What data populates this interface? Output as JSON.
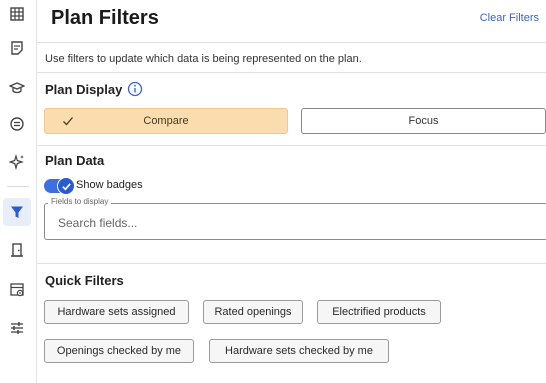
{
  "sidebar": {
    "items": [
      {
        "icon": "grid-icon",
        "active": false
      },
      {
        "icon": "document-icon",
        "active": false
      },
      {
        "icon": "graduation-cap-icon",
        "active": false
      },
      {
        "icon": "circle-lines-icon",
        "active": false
      },
      {
        "icon": "sparkle-icon",
        "active": false
      },
      {
        "icon": "filter-icon",
        "active": true
      },
      {
        "icon": "door-icon",
        "active": false
      },
      {
        "icon": "view-list-icon",
        "active": false
      },
      {
        "icon": "sliders-icon",
        "active": false
      }
    ],
    "accent_color": "#2b5ad3"
  },
  "header": {
    "title": "Plan Filters",
    "clear_label": "Clear Filters"
  },
  "description": "Use filters to update which data is being represented on the plan.",
  "plan_display": {
    "heading": "Plan Display",
    "options": [
      {
        "label": "Compare",
        "selected": true
      },
      {
        "label": "Focus",
        "selected": false
      }
    ]
  },
  "plan_data": {
    "heading": "Plan Data",
    "show_badges_label": "Show badges",
    "show_badges_on": true,
    "fields_legend": "Fields to display",
    "fields_placeholder": "Search fields..."
  },
  "quick_filters": {
    "heading": "Quick Filters",
    "chips": [
      "Hardware sets assigned",
      "Rated openings",
      "Electrified products",
      "Openings checked by me",
      "Hardware sets checked by me"
    ]
  }
}
